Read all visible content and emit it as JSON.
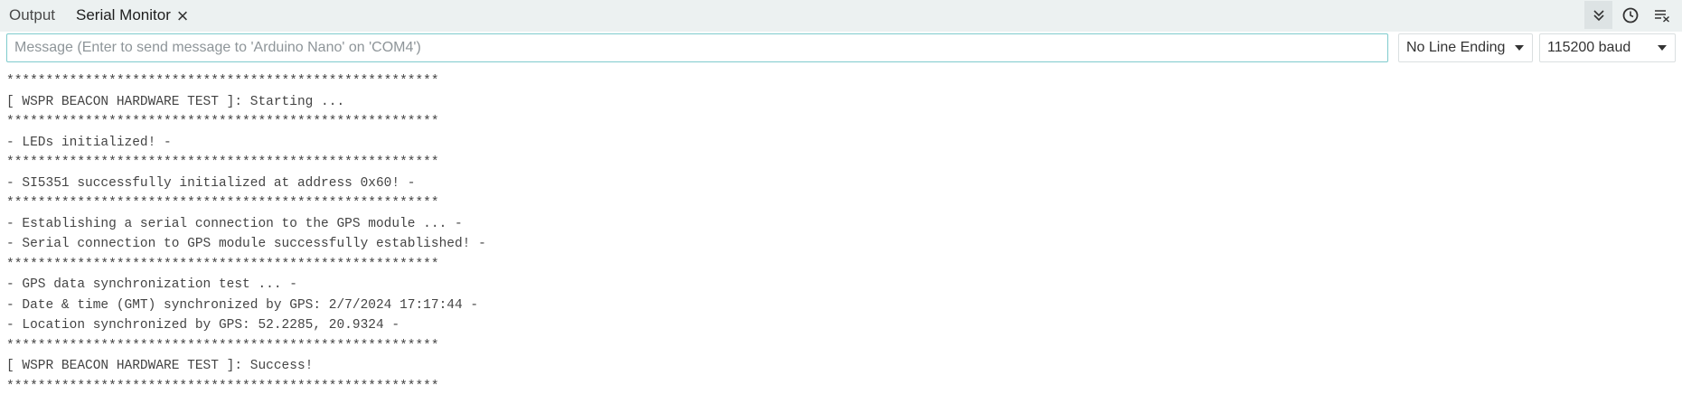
{
  "tabs": {
    "output_label": "Output",
    "serial_monitor_label": "Serial Monitor",
    "close_icon": "×"
  },
  "toolbar": {
    "autoscroll_icon": "chevrons-down-icon",
    "timestamp_icon": "clock-icon",
    "clear_icon": "clear-output-icon"
  },
  "message": {
    "placeholder": "Message (Enter to send message to 'Arduino Nano' on 'COM4')",
    "value": ""
  },
  "line_ending": {
    "selected": "No Line Ending"
  },
  "baud_rate": {
    "selected": "115200 baud"
  },
  "colors": {
    "accent_border": "#7fcbcd",
    "topbar_bg": "#ecf1f1",
    "text": "#444444"
  },
  "console": {
    "lines": [
      "*******************************************************",
      "[ WSPR BEACON HARDWARE TEST ]: Starting ...",
      "*******************************************************",
      "- LEDs initialized! -",
      "*******************************************************",
      "- SI5351 successfully initialized at address 0x60! -",
      "*******************************************************",
      "- Establishing a serial connection to the GPS module ... -",
      "- Serial connection to GPS module successfully established! -",
      "*******************************************************",
      "- GPS data synchronization test ... -",
      "- Date & time (GMT) synchronized by GPS: 2/7/2024 17:17:44 -",
      "- Location synchronized by GPS: 52.2285, 20.9324 -",
      "*******************************************************",
      "[ WSPR BEACON HARDWARE TEST ]: Success!",
      "*******************************************************"
    ]
  }
}
